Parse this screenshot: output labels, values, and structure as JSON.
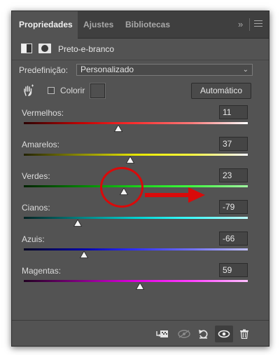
{
  "tabs": [
    {
      "label": "Propriedades",
      "active": true
    },
    {
      "label": "Ajustes",
      "active": false
    },
    {
      "label": "Bibliotecas",
      "active": false
    }
  ],
  "tabbar": {
    "more": "»"
  },
  "header": {
    "title": "Preto-e-branco"
  },
  "preset": {
    "label": "Predefinição:",
    "value": "Personalizado"
  },
  "tint": {
    "label": "Colorir",
    "checked": false
  },
  "auto_button": {
    "label": "Automático"
  },
  "channels": [
    {
      "label": "Vermelhos:",
      "value": "11",
      "gradient": [
        "#2a0000",
        "#c00000",
        "#ff3030",
        "#ff7a7a",
        "#ffffff"
      ]
    },
    {
      "label": "Amarelos:",
      "value": "37",
      "gradient": [
        "#222200",
        "#8a8a00",
        "#e6e600",
        "#ffff40",
        "#ffffff"
      ]
    },
    {
      "label": "Verdes:",
      "value": "23",
      "gradient": [
        "#002200",
        "#008000",
        "#19d019",
        "#40ff40",
        "#a0ffa0"
      ]
    },
    {
      "label": "Cianos:",
      "value": "-79",
      "gradient": [
        "#002222",
        "#008080",
        "#00d0d0",
        "#40ffff",
        "#c0ffff"
      ]
    },
    {
      "label": "Azuis:",
      "value": "-66",
      "gradient": [
        "#000022",
        "#0000a0",
        "#3030ff",
        "#7070ff",
        "#c0c0ff"
      ]
    },
    {
      "label": "Magentas:",
      "value": "59",
      "gradient": [
        "#220022",
        "#800080",
        "#e000e0",
        "#ff40ff",
        "#ffc0ff"
      ]
    }
  ],
  "annotation_color": "#d90a0a",
  "icons": [
    "adjustment-layer-icon",
    "mask-icon",
    "targeted-adjust-hand-icon",
    "clip-to-layer-icon",
    "view-previous-icon",
    "reset-icon",
    "visibility-eye-icon",
    "trash-icon"
  ]
}
